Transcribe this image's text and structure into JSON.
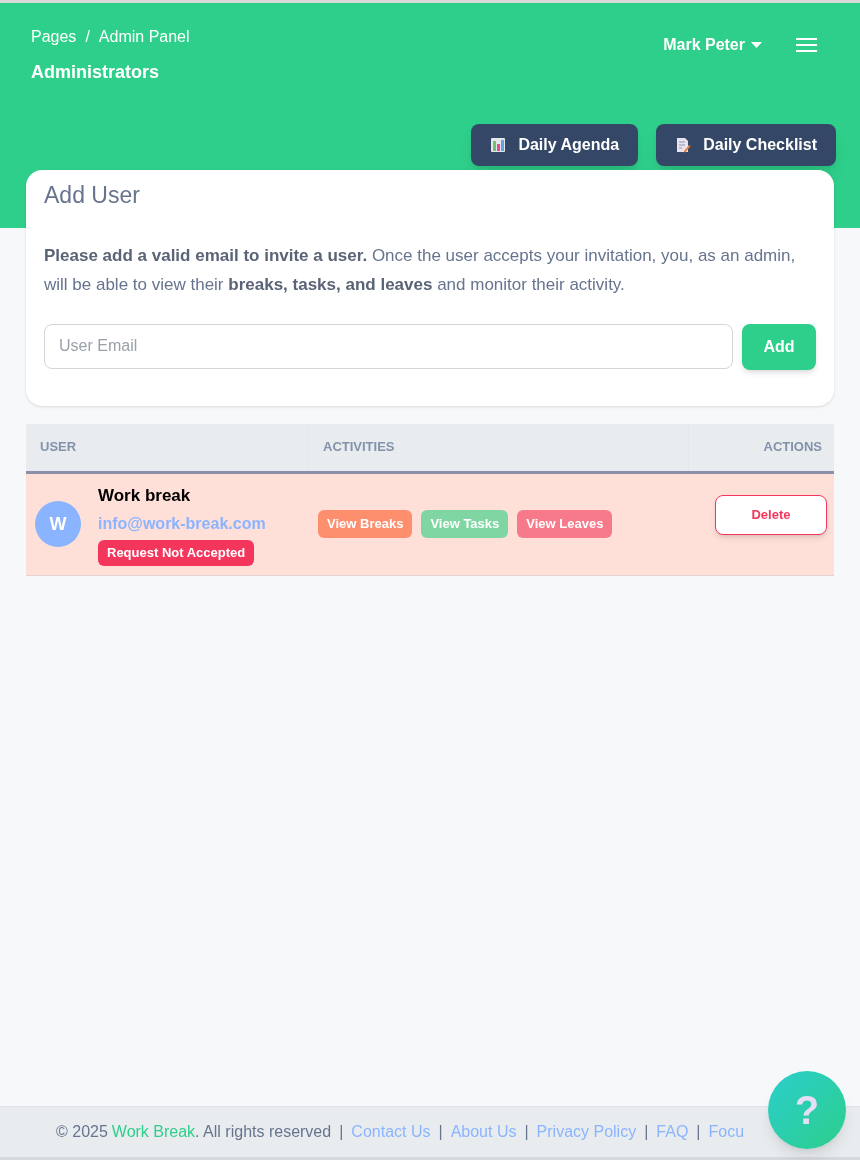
{
  "header": {
    "breadcrumb": [
      {
        "label": "Pages"
      },
      {
        "separator": "/",
        "label": "Admin Panel"
      }
    ],
    "title": "Administrators",
    "user_menu": "Mark Peter",
    "buttons": [
      {
        "label": "Daily Agenda",
        "kind": "agenda"
      },
      {
        "label": "Daily Checklist",
        "kind": "checklist"
      }
    ]
  },
  "add_user": {
    "title": "Add User",
    "description": "**Please add a valid email to invite a user.** Once the user accepts your invitation, you, as an admin, will be able to view their **breaks, tasks, and leaves** and monitor their activity.",
    "email": {
      "placeholder": "User Email"
    },
    "button": "Add"
  },
  "table": {
    "columns": [
      "USER",
      "ACTIVITIES",
      "ACTIONS"
    ],
    "rows": [
      {
        "avatar": "W",
        "name": "Work break",
        "email": "info@work-break.com",
        "status": "Request Not Accepted",
        "activities": [
          {
            "label": "View Breaks",
            "color": "#fd8f6f"
          },
          {
            "label": "View Tasks",
            "color": "#7fd6a3"
          },
          {
            "label": "View Leaves",
            "color": "#f77a8a"
          }
        ],
        "action": "Delete"
      }
    ]
  },
  "footer": {
    "copyright": "© 2025",
    "brand": "Work Break",
    "rights": ". All rights reserved",
    "links": [
      {
        "separator": "|",
        "label": "Contact Us"
      },
      {
        "separator": "|",
        "label": "About Us"
      },
      {
        "separator": "|",
        "label": "Privacy Policy"
      },
      {
        "separator": "|",
        "label": "FAQ"
      },
      {
        "separator": "|",
        "label": "Focu"
      }
    ]
  },
  "help_button": "?"
}
